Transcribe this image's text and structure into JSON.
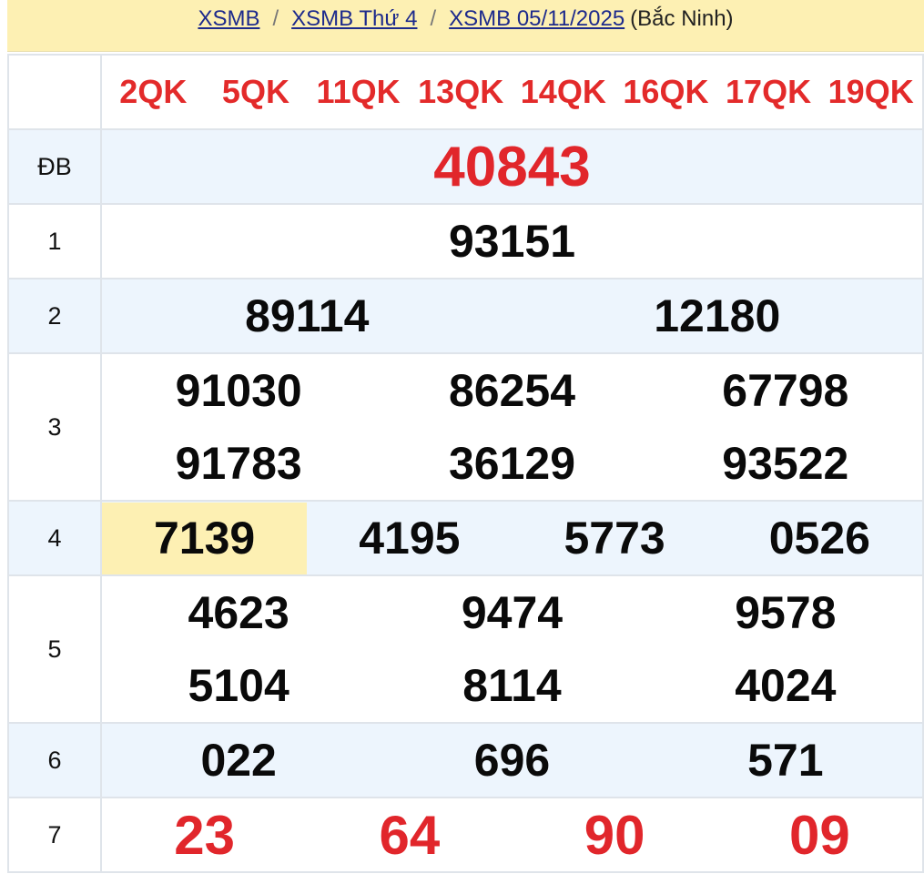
{
  "breadcrumb": {
    "link1": "XSMB",
    "sep1": "/",
    "link2": "XSMB Thứ 4",
    "sep2": "/",
    "link3": "XSMB 05/11/2025",
    "suffix": "(Bắc Ninh)"
  },
  "codes": [
    "2QK",
    "5QK",
    "11QK",
    "13QK",
    "14QK",
    "16QK",
    "17QK",
    "19QK"
  ],
  "prizes": {
    "db": {
      "label": "ĐB",
      "numbers": [
        "40843"
      ]
    },
    "p1": {
      "label": "1",
      "numbers": [
        "93151"
      ]
    },
    "p2": {
      "label": "2",
      "numbers": [
        "89114",
        "12180"
      ]
    },
    "p3": {
      "label": "3",
      "numbers": [
        "91030",
        "86254",
        "67798",
        "91783",
        "36129",
        "93522"
      ]
    },
    "p4": {
      "label": "4",
      "numbers": [
        "7139",
        "4195",
        "5773",
        "0526"
      ]
    },
    "p5": {
      "label": "5",
      "numbers": [
        "4623",
        "9474",
        "9578",
        "5104",
        "8114",
        "4024"
      ]
    },
    "p6": {
      "label": "6",
      "numbers": [
        "022",
        "696",
        "571"
      ]
    },
    "p7": {
      "label": "7",
      "numbers": [
        "23",
        "64",
        "90",
        "09"
      ]
    }
  },
  "colors": {
    "breadcrumb_bg": "#fdf0b3",
    "highlight": "#fdf0b3",
    "accent_red": "#e1262b",
    "alt_row": "#edf5fd",
    "link": "#1d2a8c"
  }
}
